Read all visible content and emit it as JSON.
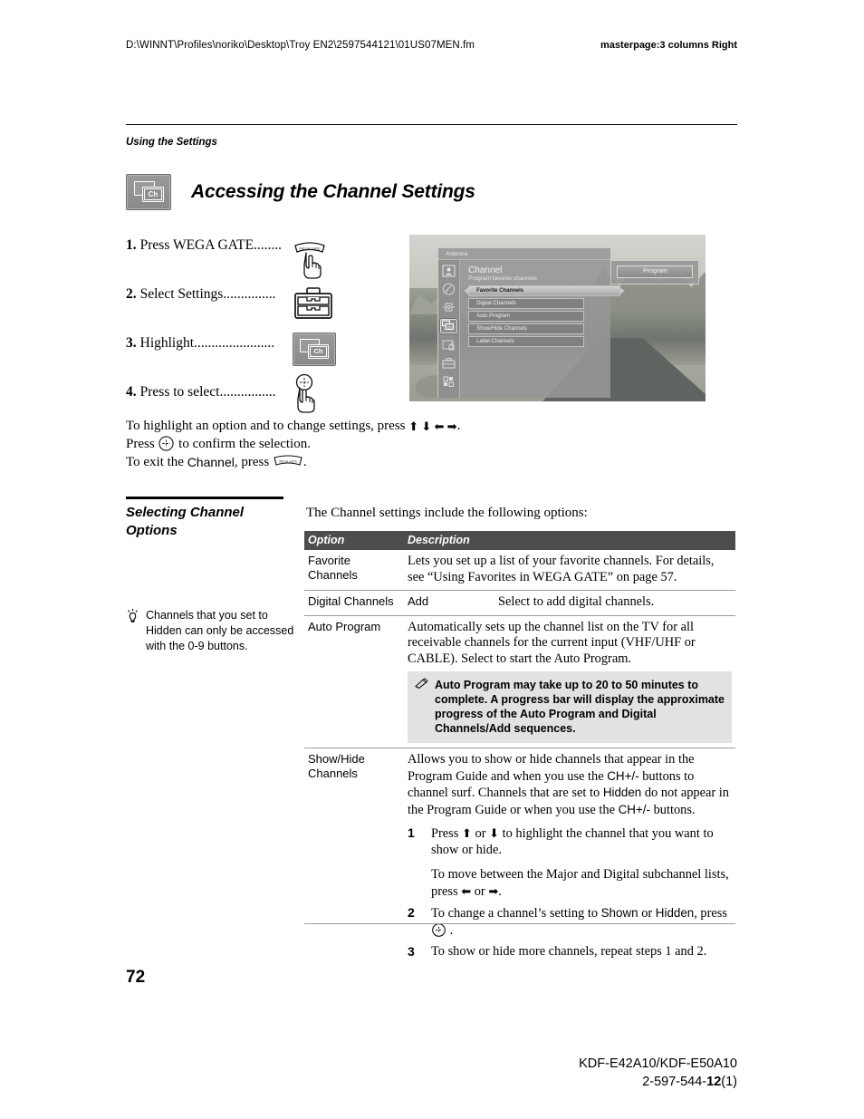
{
  "header": {
    "path": "D:\\WINNT\\Profiles\\noriko\\Desktop\\Troy EN2\\2597544121\\01US07MEN.fm",
    "masterpage": "masterpage:3 columns Right"
  },
  "running_head": "Using the Settings",
  "chapter": {
    "title": "Accessing the Channel Settings",
    "icon_label": "Ch"
  },
  "steps": [
    {
      "num": "1.",
      "text": "Press WEGA GATE........",
      "icon": "wega-gate-button-hand-icon"
    },
    {
      "num": "2.",
      "text": "Select Settings...............",
      "icon": "toolbox-settings-icon"
    },
    {
      "num": "3.",
      "text": "Highlight.......................",
      "icon": "channel-ch-icon"
    },
    {
      "num": "4.",
      "text": "Press to select................",
      "icon": "select-button-hand-icon"
    }
  ],
  "tv_screen": {
    "menu_title": "Antenna",
    "heading": "Channel",
    "subheading": "Program favorite channels",
    "items": [
      "Favorite Channels",
      "Digital Channels",
      "Auto Program",
      "Show/Hide Channels",
      "Label Channels"
    ],
    "active_item": "Favorite Channels",
    "submenu_button": "Program",
    "rail_icons": [
      "person-icon",
      "palette-icon",
      "speaker-icon",
      "channel-ch-icon",
      "parental-lock-icon",
      "toolbox-setup-icon",
      "blocks-icon"
    ]
  },
  "after_steps": {
    "line1_a": "To highlight an option and to change settings, press",
    "line1_arrows": "⬆ ⬇ ⬅ ➡",
    "line1_end": ".",
    "line2_a": "Press",
    "line2_b": "to confirm the selection.",
    "line3_a": "To exit the",
    "line3_highlight": "Channel",
    "line3_b": ", press",
    "line3_end": "."
  },
  "section": {
    "title": "Selecting Channel Options",
    "tip": "Channels that you set to Hidden can only be accessed with the 0-9 buttons.",
    "tip_icon": "lightbulb-tip-icon"
  },
  "intro": "The Channel settings include the following options:",
  "table": {
    "headers": [
      "Option",
      "Description"
    ],
    "rows": [
      {
        "option": "Favorite Channels",
        "description": "Lets you set up a list of your favorite channels. For details, see “Using Favorites in WEGA GATE” on page 57."
      },
      {
        "option": "Digital Channels",
        "sub_label": "Add",
        "description": "Select to add digital channels."
      },
      {
        "option": "Auto Program",
        "description": "Automatically sets up the channel list on the TV for all receivable channels for the current input (VHF/UHF or CABLE). Select to start the Auto Program.",
        "note_icon": "note-pencil-icon",
        "note": "Auto Program may take up to 20 to 50 minutes to complete. A progress bar will display the approximate progress of the Auto Program and Digital Channels/Add sequences."
      },
      {
        "option": "Show/Hide Channels",
        "description_p1_a": "Allows you to show or hide channels that appear in the Program Guide and when you use the",
        "description_p1_ch": "CH+/-",
        "description_p1_b": "buttons to channel surf. Channels that are set to",
        "description_p1_hidden": "Hidden",
        "description_p1_c": "do not appear in the Program Guide or when you use the",
        "description_p1_ch2": "CH+/-",
        "description_p1_d": "buttons.",
        "substeps": [
          {
            "num": "1",
            "text_a": "Press",
            "arrow_up": "⬆",
            "text_or": "or",
            "arrow_down": "⬇",
            "text_b": "to highlight the channel that you want to show or hide.",
            "text_c": "To move between the Major and Digital subchannel lists, press",
            "arrow_left": "⬅",
            "text_or2": "or",
            "arrow_right": "➡",
            "text_d": "."
          },
          {
            "num": "2",
            "text_a": "To change a channel’s setting to",
            "shown": "Shown",
            "text_or": "or",
            "hidden": "Hidden",
            "text_b": ", press",
            "text_c": "."
          },
          {
            "num": "3",
            "text_a": "To show or hide more channels, repeat steps 1 and 2."
          }
        ]
      }
    ]
  },
  "page_number": "72",
  "footer": {
    "model": "KDF-E42A10/KDF-E50A10",
    "doc_prefix": "2-597-544-",
    "doc_bold": "12",
    "doc_suffix": "(1)"
  },
  "colors": {
    "table_header_bg": "#4d4d4d",
    "note_bg": "#e2e2e2",
    "rule": "#000000"
  }
}
